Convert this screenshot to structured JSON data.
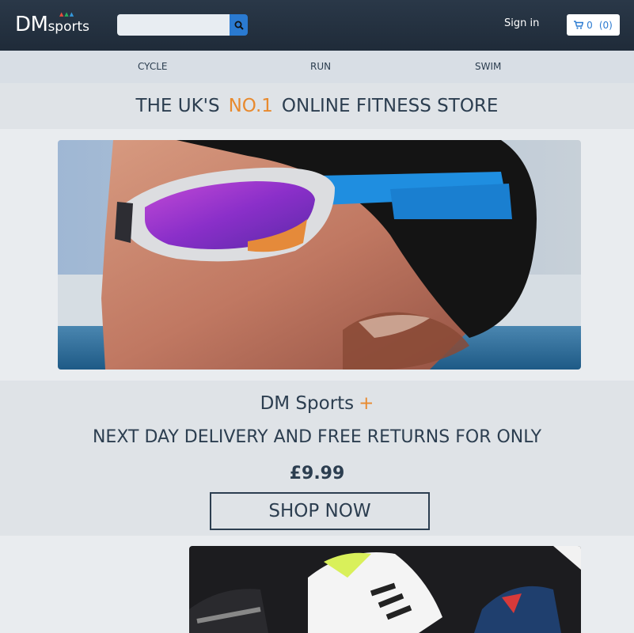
{
  "header": {
    "logo_dm": "DM",
    "logo_sports": "sports",
    "search_placeholder": "",
    "signin_label": "Sign in",
    "cart_count": "0",
    "cart_items": "(0)"
  },
  "nav": {
    "items": [
      {
        "label": "CYCLE"
      },
      {
        "label": "RUN"
      },
      {
        "label": "SWIM"
      }
    ]
  },
  "banner": {
    "prefix": "THE UK'S",
    "highlight": "NO.1",
    "suffix": "ONLINE FITNESS STORE"
  },
  "promo": {
    "title": "DM Sports",
    "plus": "+",
    "line": "NEXT DAY DELIVERY AND FREE RETURNS FOR ONLY",
    "price": "£9.99",
    "cta": "SHOP NOW"
  },
  "colors": {
    "header_bg": "#1f2b39",
    "accent_orange": "#e88a2e",
    "accent_blue": "#2a7ad1",
    "text_dark": "#2c3e50"
  },
  "icons": {
    "search": "search-icon",
    "cart": "cart-icon"
  }
}
